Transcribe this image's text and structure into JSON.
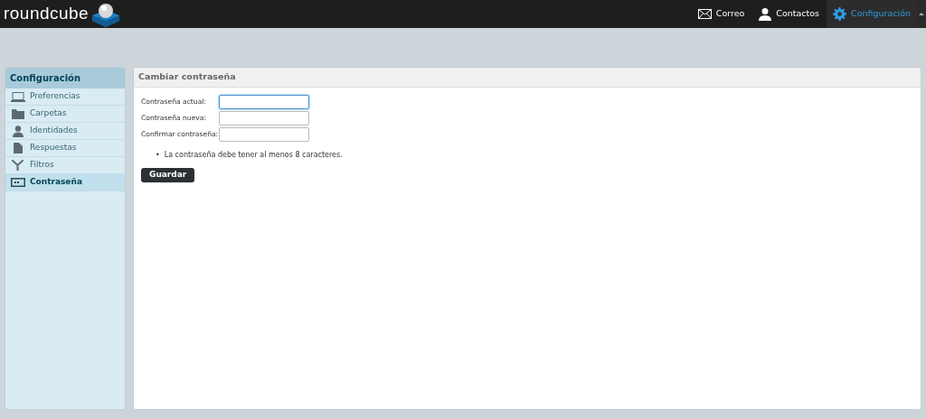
{
  "header": {
    "logo": "roundcube",
    "nav": [
      {
        "label": "Correo",
        "selected": false
      },
      {
        "label": "Contactos",
        "selected": false
      },
      {
        "label": "Configuración",
        "selected": true
      }
    ]
  },
  "sidebar": {
    "title": "Configuración",
    "items": [
      {
        "label": "Preferencias",
        "selected": false
      },
      {
        "label": "Carpetas",
        "selected": false
      },
      {
        "label": "Identidades",
        "selected": false
      },
      {
        "label": "Respuestas",
        "selected": false
      },
      {
        "label": "Filtros",
        "selected": false
      },
      {
        "label": "Contraseña",
        "selected": true
      }
    ]
  },
  "panel": {
    "title": "Cambiar contraseña",
    "fields": [
      {
        "label": "Contraseña actual:",
        "focused": true
      },
      {
        "label": "Contraseña nueva:",
        "focused": false
      },
      {
        "label": "Confirmar contraseña:",
        "focused": false
      }
    ],
    "hints": [
      {
        "marker": "•",
        "text": "La contraseña debe tener al menos 8 caracteres."
      }
    ],
    "button": "Guardar"
  }
}
